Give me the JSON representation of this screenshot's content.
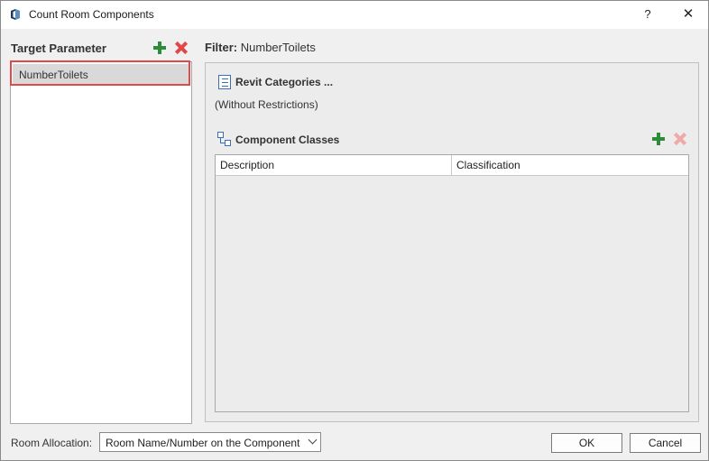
{
  "window": {
    "title": "Count Room Components",
    "help": "?",
    "close": "✕"
  },
  "left": {
    "title": "Target Parameter",
    "items": [
      {
        "label": "NumberToilets",
        "selected": true
      }
    ]
  },
  "filter": {
    "prefix": "Filter:",
    "name": "NumberToilets",
    "revit_categories_label": "Revit Categories ...",
    "restrictions": "(Without Restrictions)",
    "component_classes_label": "Component Classes",
    "table": {
      "columns": [
        "Description",
        "Classification"
      ],
      "rows": []
    }
  },
  "footer": {
    "room_allocation_label": "Room Allocation:",
    "room_allocation_value": "Room Name/Number on the Component",
    "ok": "OK",
    "cancel": "Cancel"
  },
  "colors": {
    "add": "#2e8b3a",
    "remove": "#e04848",
    "highlight": "#e04a4a"
  }
}
